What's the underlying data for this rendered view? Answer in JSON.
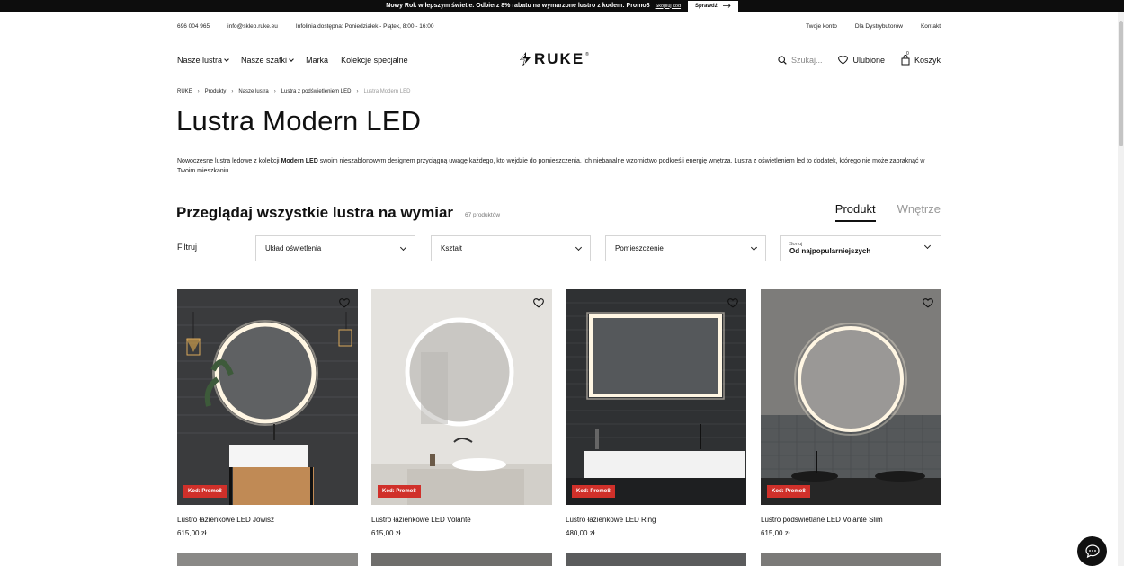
{
  "promo": {
    "text": "Nowy Rok w lepszym świetle. Odbierz 8% rabatu na wymarzone lustro z kodem: Promo8",
    "link": "Skopiuj kod",
    "button": "Sprawdź"
  },
  "topbar": {
    "phone": "696 004 965",
    "email": "info@sklep.ruke.eu",
    "hours": "Infolinia dostępna: Poniedziałek - Piątek, 8:00 - 16:00",
    "account": "Twoje konto",
    "distributors": "Dla Dystrybutorów",
    "contact": "Kontakt"
  },
  "nav": {
    "mirrors": "Nasze lustra",
    "cabinets": "Nasze szafki",
    "brand": "Marka",
    "collections": "Kolekcje specjalne"
  },
  "logo": {
    "text": "RUKE",
    "mark": "®"
  },
  "header_right": {
    "search_placeholder": "Szukaj...",
    "favorites": "Ulubione",
    "cart": "Koszyk",
    "cart_count": "0"
  },
  "breadcrumb": {
    "items": [
      "RUKE",
      "Produkty",
      "Nasze lustra",
      "Lustra z podświetleniem LED"
    ],
    "current": "Lustra Modern LED"
  },
  "page_title": "Lustra Modern LED",
  "intro": {
    "before": "Nowoczesne lustra ledowe z kolekcji ",
    "bold": "Modern LED",
    "after": " swoim nieszablonowym designem przyciągną uwagę każdego, kto wejdzie do pomieszczenia. Ich niebanalne wzornictwo podkreśli energię wnętrza. Lustra z oświetleniem led to dodatek, którego nie może zabraknąć w Twoim mieszkaniu."
  },
  "section": {
    "title": "Przeglądaj wszystkie lustra na wymiar",
    "count": "67 produktów"
  },
  "view_tabs": {
    "product": "Produkt",
    "interior": "Wnętrze"
  },
  "filters": {
    "label": "Filtruj",
    "lighting": "Układ oświetlenia",
    "shape": "Kształt",
    "room": "Pomieszczenie",
    "sort_label": "Sortuj",
    "sort_value": "Od najpopularniejszych"
  },
  "products": [
    {
      "name": "Lustro łazienkowe LED Jowisz",
      "price": "615,00 zł",
      "badge": "Kod: Promo8"
    },
    {
      "name": "Lustro łazienkowe LED Volante",
      "price": "615,00 zł",
      "badge": "Kod: Promo8"
    },
    {
      "name": "Lustro łazienkowe LED Ring",
      "price": "480,00 zł",
      "badge": "Kod: Promo8"
    },
    {
      "name": "Lustro podświetlane LED Volante Slim",
      "price": "615,00 zł",
      "badge": "Kod: Promo8"
    }
  ],
  "colors": {
    "badge": "#d0302a",
    "dark": "#0d0d0d"
  }
}
